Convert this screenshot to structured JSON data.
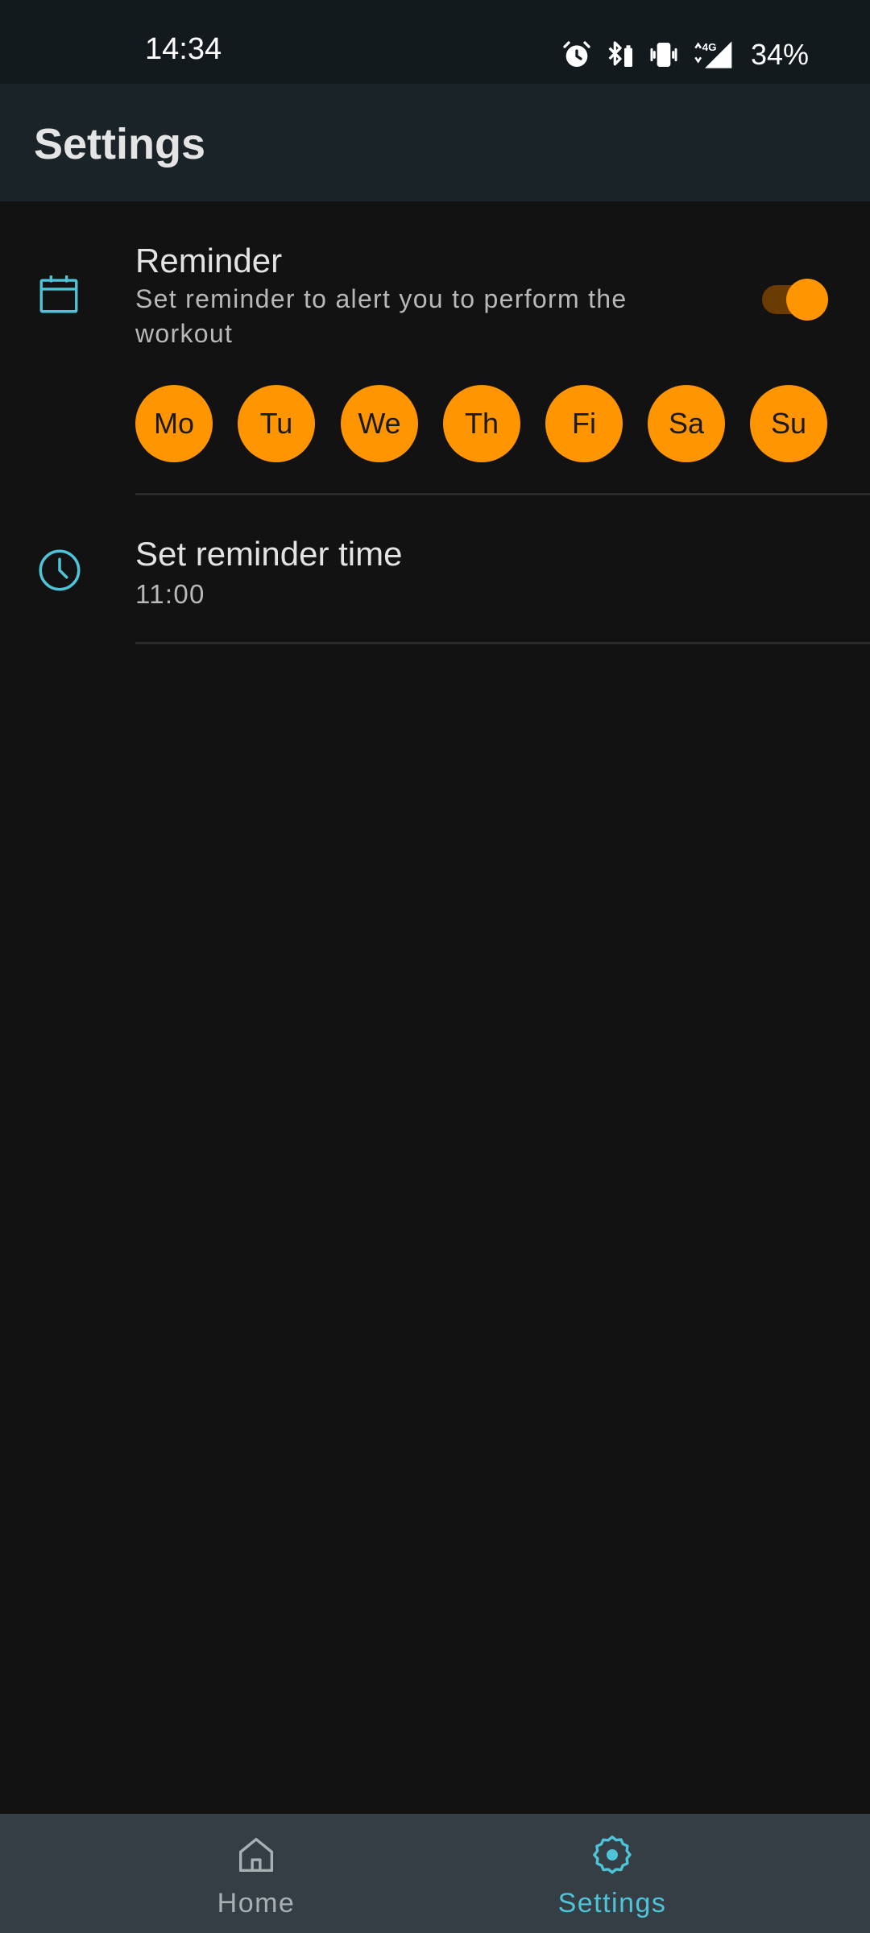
{
  "status_bar": {
    "time": "14:34",
    "battery": "34%",
    "icons": [
      "alarm-icon",
      "bluetooth-battery-icon",
      "vibrate-icon",
      "signal-4g-icon"
    ]
  },
  "app_bar": {
    "title": "Settings"
  },
  "reminder": {
    "icon": "calendar-icon",
    "title": "Reminder",
    "subtitle_line1": "Set reminder to alert you to perform the",
    "subtitle_line2": "workout",
    "enabled": true,
    "days": [
      "Mo",
      "Tu",
      "We",
      "Th",
      "Fi",
      "Sa",
      "Su"
    ]
  },
  "reminder_time": {
    "icon": "clock-icon",
    "title": "Set reminder time",
    "value": "11:00"
  },
  "bottom_nav": {
    "items": [
      {
        "label": "Home",
        "icon": "home-icon",
        "active": false
      },
      {
        "label": "Settings",
        "icon": "gear-icon",
        "active": true
      }
    ]
  },
  "colors": {
    "accent": "#FF9500",
    "icon_tint": "#4FC3D7",
    "background": "#121212",
    "app_bar": "#1A2428",
    "bottom_nav": "#343E44"
  }
}
